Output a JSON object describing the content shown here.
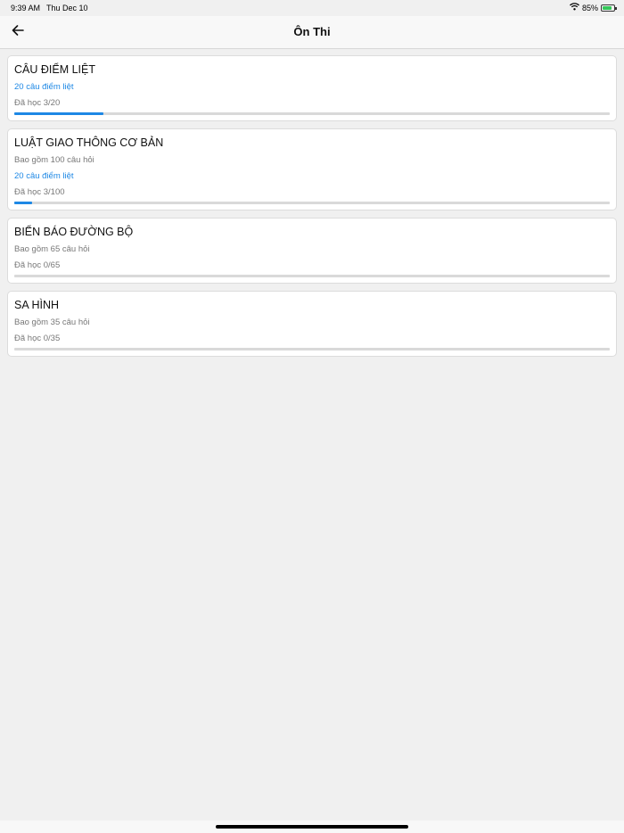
{
  "status": {
    "time": "9:39 AM",
    "date": "Thu Dec 10",
    "battery_pct": "85%",
    "battery_level": 0.85
  },
  "header": {
    "title": "Ôn Thi",
    "back_icon": "arrow-left-icon"
  },
  "sections": [
    {
      "title": "CÂU ĐIỂM LIỆT",
      "subtitle": "",
      "highlight": "20 câu điểm liệt",
      "progress_label": "Đã học 3/20",
      "progress": 0.15
    },
    {
      "title": "LUẬT GIAO THÔNG CƠ BẢN",
      "subtitle": "Bao gồm 100 câu hỏi",
      "highlight": "20 câu điểm liệt",
      "progress_label": "Đã học 3/100",
      "progress": 0.03
    },
    {
      "title": "BIỂN BÁO ĐƯỜNG BỘ",
      "subtitle": "Bao gồm 65 câu hỏi",
      "highlight": "",
      "progress_label": "Đã học 0/65",
      "progress": 0
    },
    {
      "title": "SA HÌNH",
      "subtitle": "Bao gồm 35 câu hỏi",
      "highlight": "",
      "progress_label": "Đã học 0/35",
      "progress": 0
    }
  ],
  "colors": {
    "accent": "#1e88e5",
    "background": "#f0f0f0",
    "track": "#d9d9d9"
  }
}
